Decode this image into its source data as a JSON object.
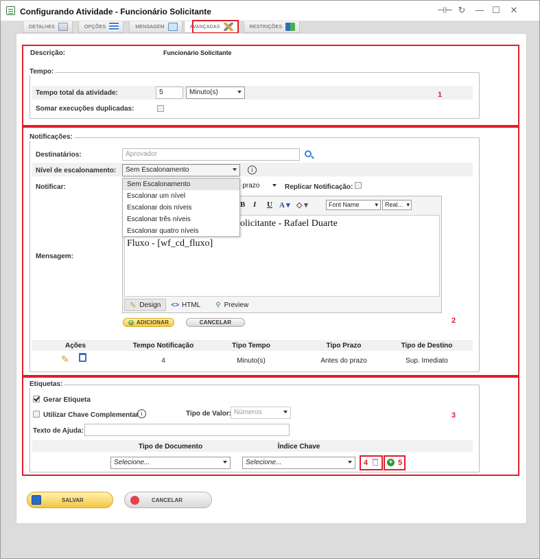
{
  "window": {
    "title": "Configurando Atividade - Funcionário Solicitante",
    "controls": [
      "⊣⊢",
      "↻",
      "—",
      "☐",
      "✕"
    ]
  },
  "tabs": [
    {
      "label": "DETALHES",
      "icon": "document-icon"
    },
    {
      "label": "OPÇÕES",
      "icon": "list-icon"
    },
    {
      "label": "MENSAGEM",
      "icon": "envelope-icon"
    },
    {
      "label": "AVANÇADAS",
      "icon": "tools-icon"
    },
    {
      "label": "RESTRIÇÕES",
      "icon": "restriction-icon"
    }
  ],
  "general": {
    "descricao_label": "Descrição:",
    "descricao_value": "Funcionário Solicitante"
  },
  "tempo": {
    "legend": "Tempo:",
    "total_label": "Tempo total da atividade:",
    "total_value": "5",
    "unit_value": "Minuto(s)",
    "somar_label": "Somar execuções duplicadas:"
  },
  "notificacoes": {
    "legend": "Notificações:",
    "destinatarios_label": "Destinatários:",
    "destinatarios_placeholder": "Aprovador",
    "nivel_label": "Nível de escalonamento:",
    "nivel_value": "Sem Escalonamento",
    "nivel_options": [
      "Sem Escalonamento",
      "Escalonar um nível",
      "Escalonar dois níveis",
      "Escalonar três níveis",
      "Escalonar quatro níveis"
    ],
    "notificar_label": "Notificar:",
    "notificar_value": "o prazo",
    "replicar_label": "Replicar Notificação:",
    "mensagem_label": "Mensagem:",
    "editor": {
      "font_name": "Font Name",
      "font_size": "Real...",
      "line1": "olicitante - Rafael Duarte",
      "line2": "Fluxo - [wf_cd_fluxo]",
      "mode_design": "Design",
      "mode_html": "HTML",
      "mode_preview": "Preview"
    },
    "adicionar": "ADICIONAR",
    "cancelar": "CANCELAR",
    "table": {
      "headers": [
        "Ações",
        "Tempo Notificação",
        "Tipo Tempo",
        "Tipo Prazo",
        "Tipo de Destino"
      ],
      "rows": [
        [
          "",
          "4",
          "Minuto(s)",
          "Antes do prazo",
          "Sup. Imediato"
        ]
      ]
    }
  },
  "etiquetas": {
    "legend": "Etiquetas:",
    "gerar_label": "Gerar Etiqueta",
    "chave_label": "Utilizar Chave Complementar",
    "tipo_valor_label": "Tipo de Valor:",
    "tipo_valor_value": "Números",
    "ajuda_label": "Texto de Ajuda:",
    "col_tipo_doc": "Tipo de Documento",
    "col_indice": "Índice Chave",
    "tipo_doc_value": "Selecione...",
    "indice_value": "Selecione..."
  },
  "annotations": [
    "1",
    "2",
    "3",
    "4",
    "5"
  ],
  "footer": {
    "salvar": "SALVAR",
    "cancelar": "CANCELAR"
  },
  "colors": {
    "highlight_red": "#e01d2a",
    "button_yellow": "#f5c842",
    "add_green": "#2e9a2e"
  }
}
